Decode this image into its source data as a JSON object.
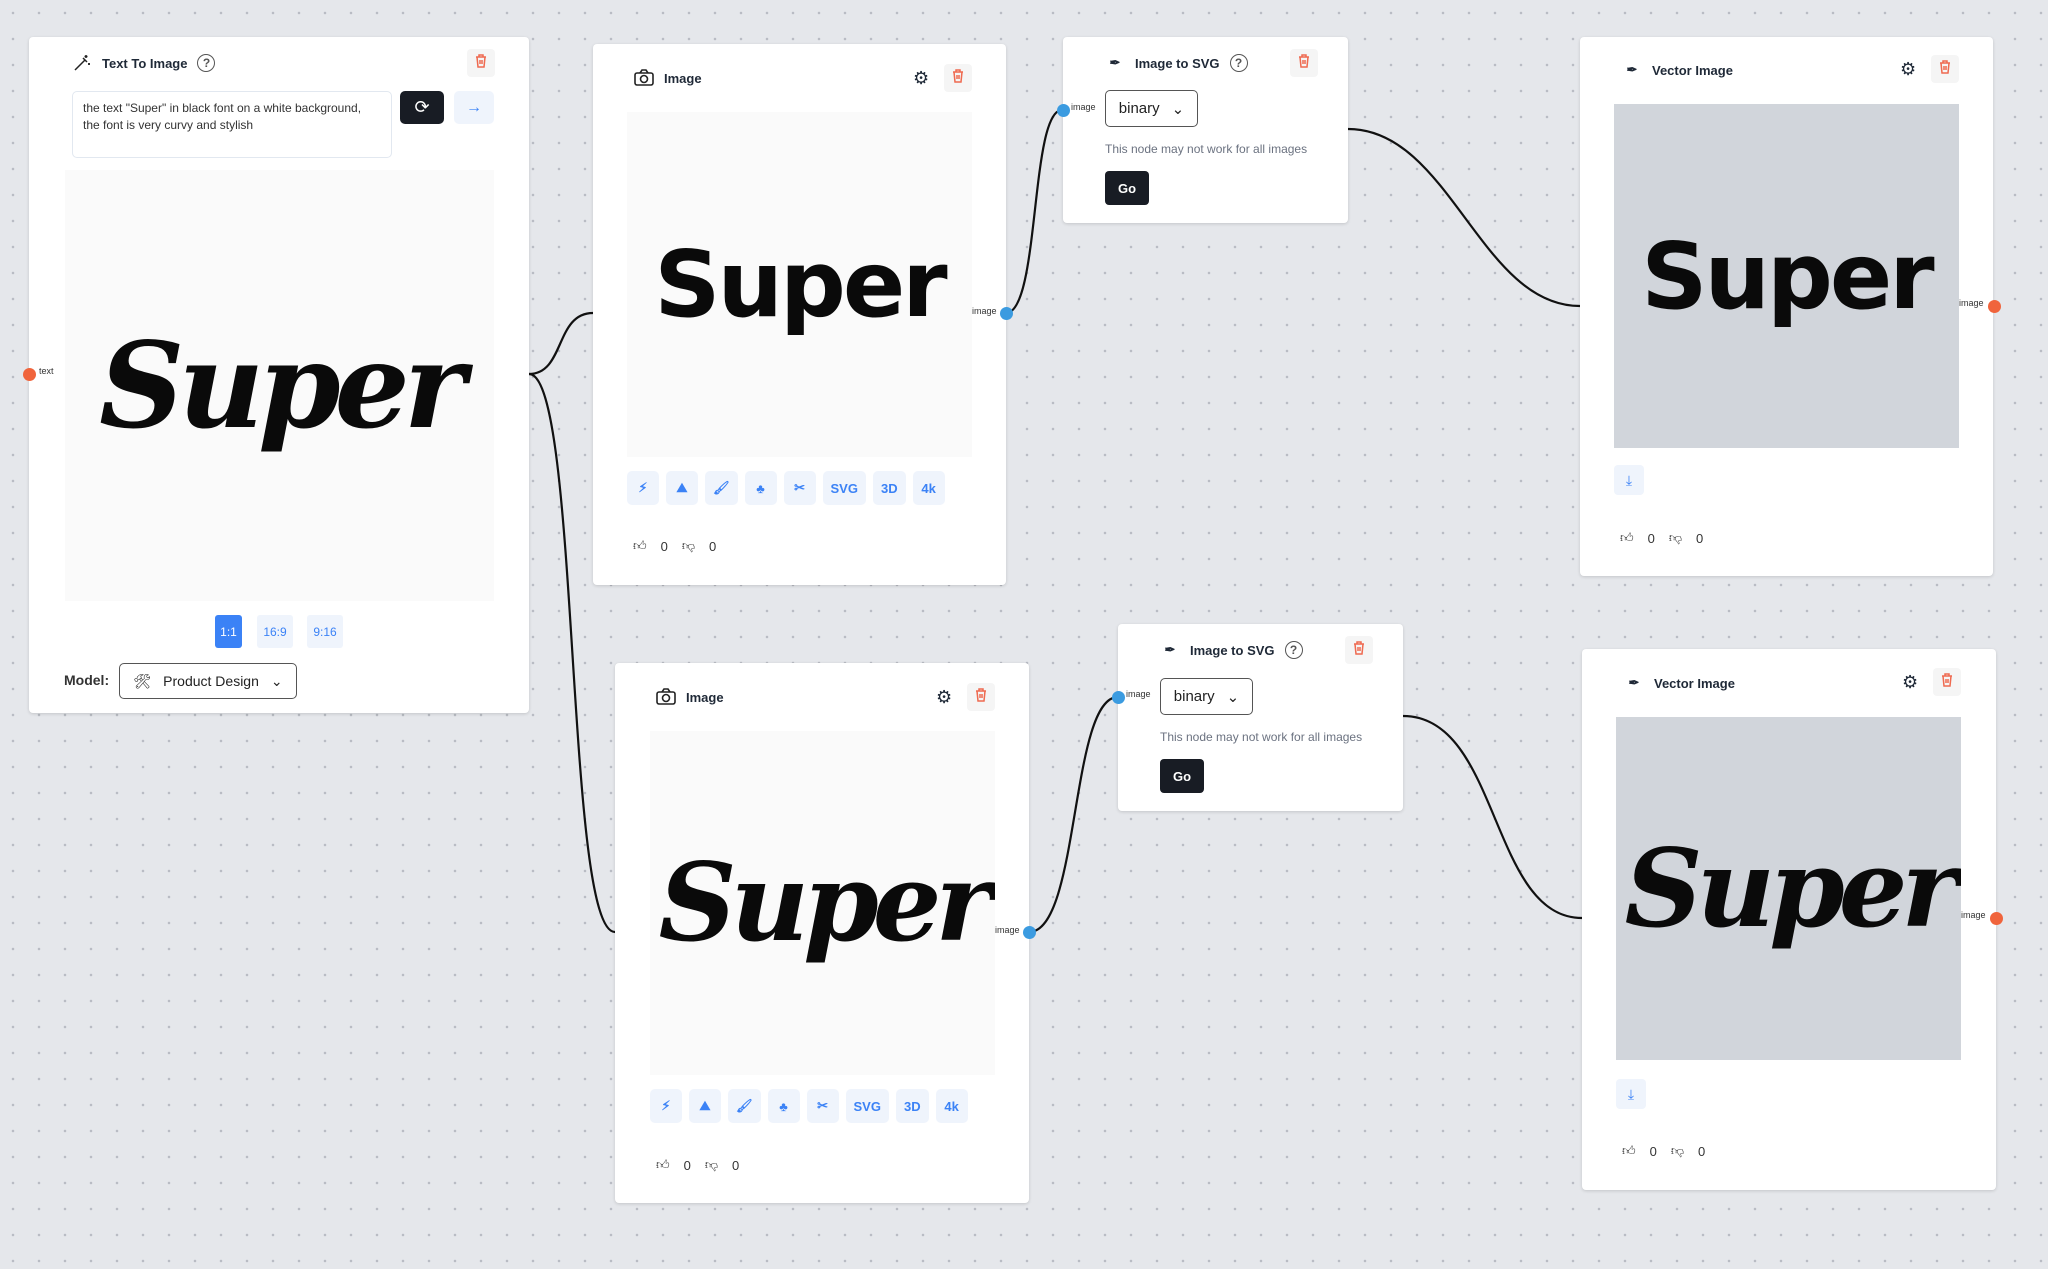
{
  "colors": {
    "accent": "#3b82f6",
    "handle_image": "#3b9be0",
    "handle_text": "#f0643c",
    "delete": "#ef6a50",
    "dark_button": "#181c24"
  },
  "text_to_image": {
    "title": "Text To Image",
    "icon": "magic-wand-icon",
    "prompt": "the text \"Super\" in black font on a white background, the font is very curvy and stylish",
    "preview_text": "Super",
    "ratios": [
      "1:1",
      "16:9",
      "9:16"
    ],
    "selected_ratio": "1:1",
    "model_label": "Model:",
    "model_value": "Product Design",
    "input_label": "text"
  },
  "image_nodes": [
    {
      "title": "Image",
      "preview_text": "Super",
      "tools": [
        "bolt-icon",
        "landscape-icon",
        "paint-brush-icon",
        "trees-icon",
        "scissors-icon",
        "SVG",
        "3D",
        "4k"
      ],
      "likes": "0",
      "dislikes": "0",
      "output_label": "image"
    },
    {
      "title": "Image",
      "preview_text": "Super",
      "tools": [
        "bolt-icon",
        "landscape-icon",
        "paint-brush-icon",
        "trees-icon",
        "scissors-icon",
        "SVG",
        "3D",
        "4k"
      ],
      "likes": "0",
      "dislikes": "0",
      "output_label": "image"
    }
  ],
  "svg_nodes": [
    {
      "title": "Image to SVG",
      "input_label": "image",
      "mode": "binary",
      "note": "This node may not work for all images",
      "go": "Go"
    },
    {
      "title": "Image to SVG",
      "input_label": "image",
      "mode": "binary",
      "note": "This node may not work for all images",
      "go": "Go"
    }
  ],
  "vector_nodes": [
    {
      "title": "Vector Image",
      "preview_text": "Super",
      "likes": "0",
      "dislikes": "0",
      "output_label": "image"
    },
    {
      "title": "Vector Image",
      "preview_text": "Super",
      "likes": "0",
      "dislikes": "0",
      "output_label": "image"
    }
  ]
}
